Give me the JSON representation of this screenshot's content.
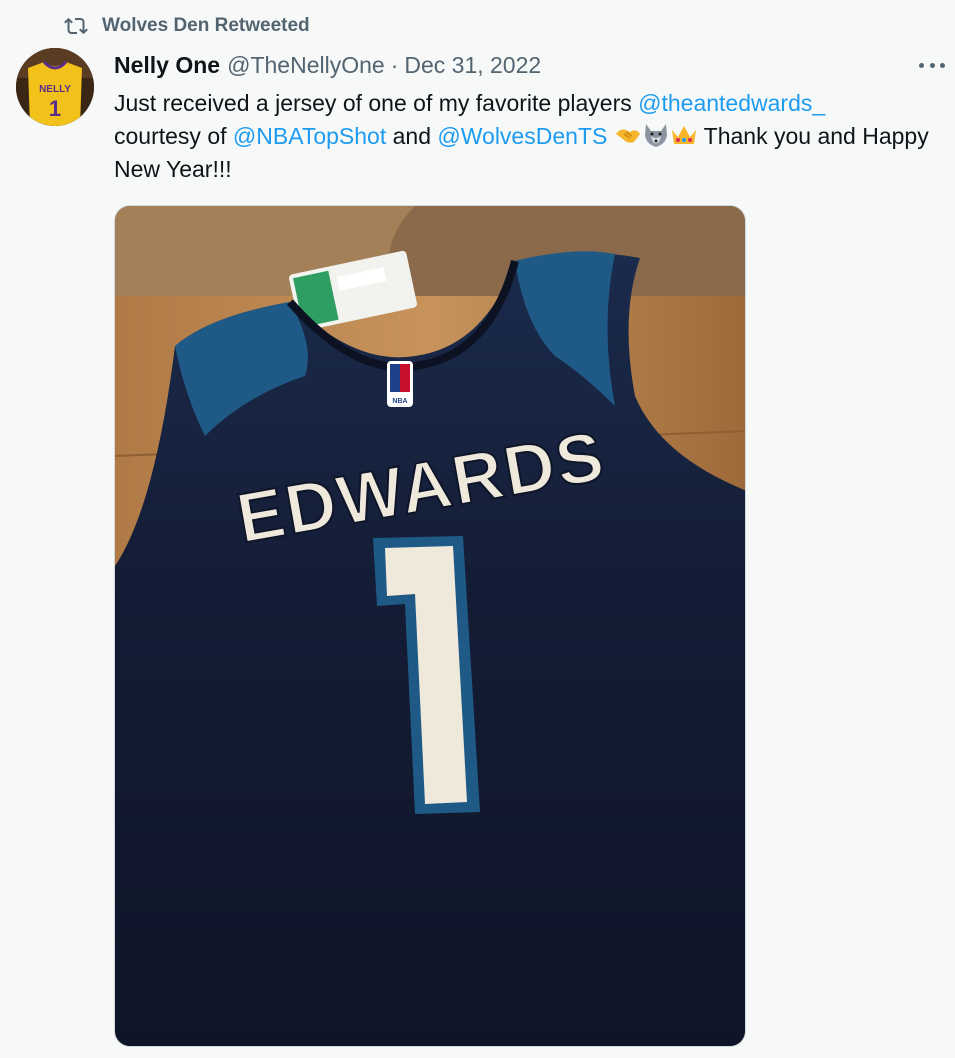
{
  "retweet": {
    "icon": "retweet-icon",
    "label": "Wolves Den Retweeted"
  },
  "author": {
    "display_name": "Nelly One",
    "handle": "@TheNellyOne",
    "separator": "·",
    "date": "Dec 31, 2022",
    "avatar_text": "NELLY",
    "avatar_number": "1"
  },
  "tweet": {
    "text_1": "Just received a jersey of one of my favorite players ",
    "mention_1": "@theantedwards_",
    "text_2": "courtesy of ",
    "mention_2": "@NBATopShot",
    "text_3": " and ",
    "mention_3": "@WolvesDenTS",
    "emojis": [
      "handshake-emoji",
      "wolf-emoji",
      "crown-emoji"
    ],
    "text_4": " Thank you and Happy New Year!!!"
  },
  "media": {
    "jersey_name": "EDWARDS",
    "jersey_number": "1",
    "logo_text": "NBA"
  },
  "colors": {
    "link": "#1d9bf0",
    "muted": "#536471",
    "jersey_navy": "#141c33",
    "jersey_blue": "#1f5a86"
  }
}
